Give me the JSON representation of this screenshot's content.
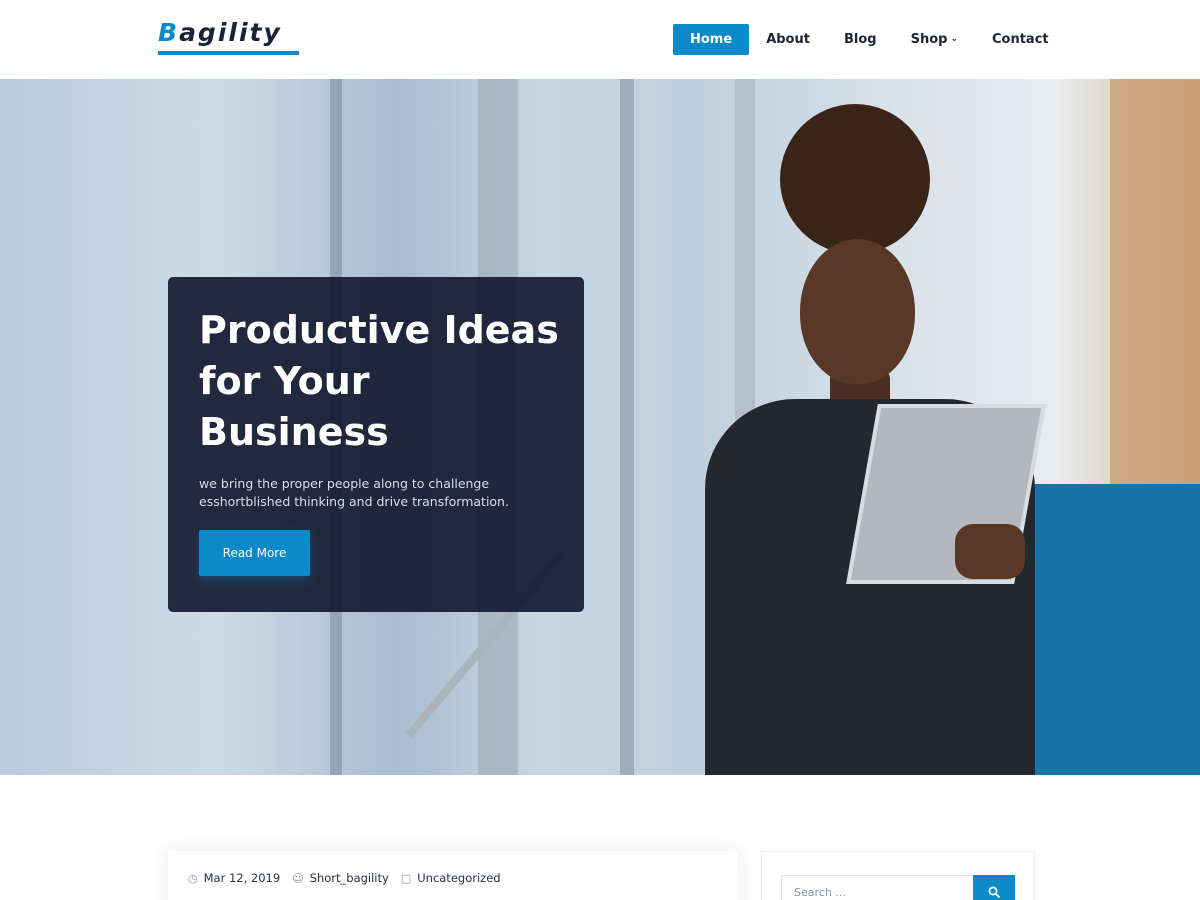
{
  "header": {
    "logo_first": "B",
    "logo_rest": "agility",
    "nav": [
      {
        "label": "Home",
        "active": true
      },
      {
        "label": "About",
        "active": false
      },
      {
        "label": "Blog",
        "active": false
      },
      {
        "label": "Shop",
        "active": false,
        "has_dropdown": true
      },
      {
        "label": "Contact",
        "active": false
      }
    ]
  },
  "hero": {
    "title": "Productive Ideas for Your Business",
    "text": "we bring the proper people along to challenge esshortblished thinking and drive transformation.",
    "button_label": "Read More"
  },
  "post": {
    "date": "Mar 12, 2019",
    "author": "Short_bagility",
    "category": "Uncategorized"
  },
  "sidebar": {
    "search_placeholder": "Search ..."
  },
  "colors": {
    "accent": "#0a8ac8",
    "dark": "#141a30",
    "text": "#1f2533"
  }
}
